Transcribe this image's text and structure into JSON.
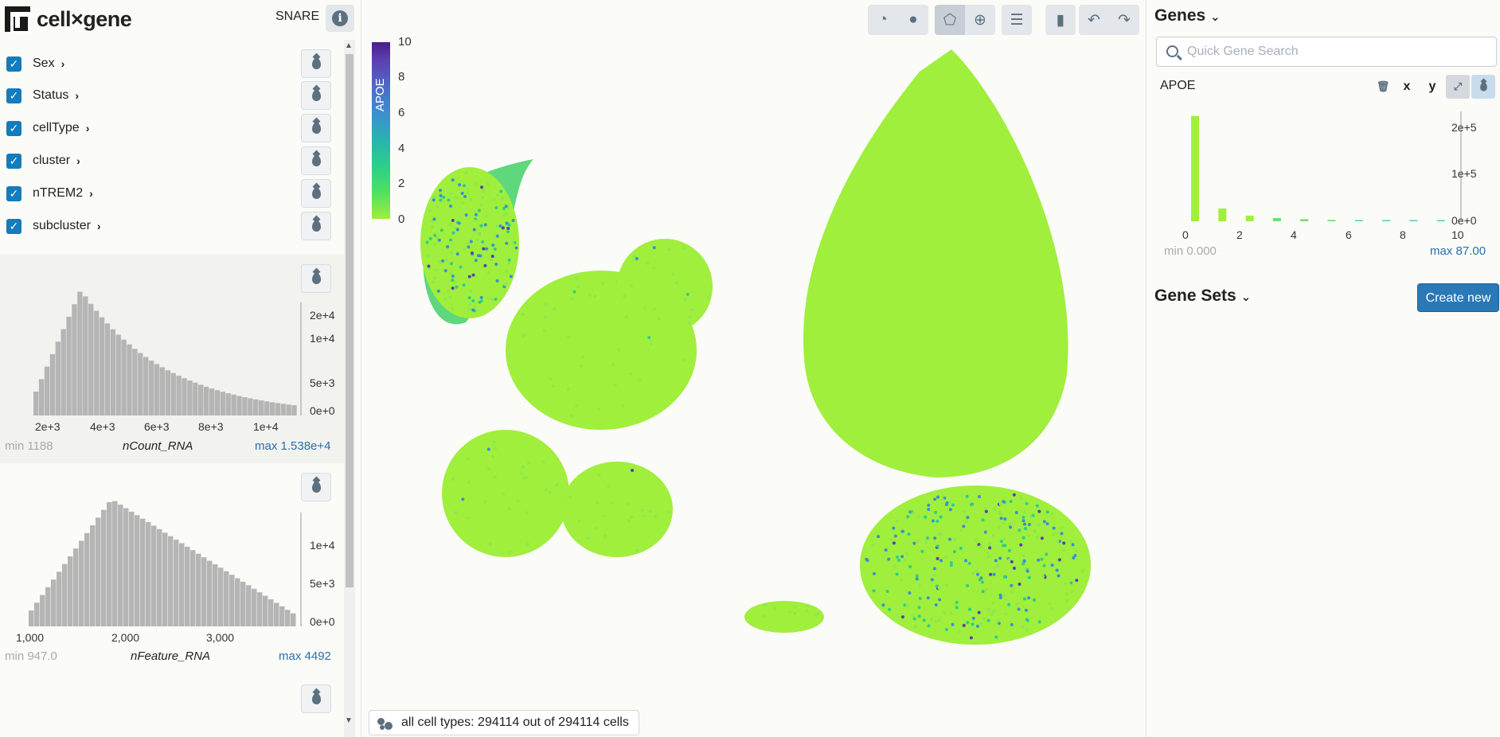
{
  "app": {
    "name": "cell×gene",
    "dataset": "SNARE"
  },
  "categories": [
    {
      "label": "Sex",
      "checked": true
    },
    {
      "label": "Status",
      "checked": true
    },
    {
      "label": "cellType",
      "checked": true
    },
    {
      "label": "cluster",
      "checked": true
    },
    {
      "label": "nTREM2",
      "checked": true
    },
    {
      "label": "subcluster",
      "checked": true
    }
  ],
  "histograms": [
    {
      "title": "nCount_RNA",
      "min": "min 1188",
      "max": "max 1.538e+4",
      "xticks": [
        "2e+3",
        "4e+3",
        "6e+3",
        "8e+3",
        "1e+4"
      ],
      "yticks": [
        "2e+4",
        "1e+4",
        "5e+3",
        "0e+0"
      ]
    },
    {
      "title": "nFeature_RNA",
      "min": "min 947.0",
      "max": "max 4492",
      "xticks": [
        "1,000",
        "2,000",
        "3,000"
      ],
      "yticks": [
        "1e+4",
        "5e+3",
        "0e+0"
      ]
    }
  ],
  "toolbar": {
    "groups": [
      [
        "pie-icon",
        "circle-icon"
      ],
      [
        "lasso-icon",
        "zoom-icon"
      ],
      [
        "list-icon"
      ],
      [
        "bar-chart-icon"
      ],
      [
        "undo-icon",
        "redo-icon"
      ]
    ]
  },
  "legend": {
    "title": "APOE",
    "ticks": [
      "10",
      "8",
      "6",
      "4",
      "2",
      "0"
    ],
    "colors": [
      "#a0ef3c",
      "#2bcf8a",
      "#3c8fd0",
      "#5c3fb0"
    ]
  },
  "status": {
    "cell_count": "all cell types: 294114 out of 294114 cells"
  },
  "genes": {
    "title": "Genes",
    "search_placeholder": "Quick Gene Search",
    "gene": "APOE",
    "gene_buttons": [
      "trash-icon",
      "x",
      "y",
      "expand-icon",
      "drop-icon"
    ],
    "hist": {
      "xticks": [
        "0",
        "2",
        "4",
        "6",
        "8",
        "10"
      ],
      "yticks": [
        "2e+5",
        "1e+5",
        "0e+0"
      ],
      "min": "min 0.000",
      "max": "max 87.00"
    }
  },
  "gene_sets": {
    "title": "Gene Sets",
    "create_label": "Create new"
  },
  "chart_data": {
    "type": "bar",
    "title": "",
    "x": [
      0,
      1,
      2,
      3,
      4,
      5,
      6,
      7,
      8,
      9
    ],
    "values": [
      230000,
      28000,
      12000,
      7000,
      4500,
      3000,
      2000,
      1500,
      1000,
      800
    ],
    "xlim": [
      0,
      10
    ],
    "ylim": [
      0,
      240000
    ]
  }
}
